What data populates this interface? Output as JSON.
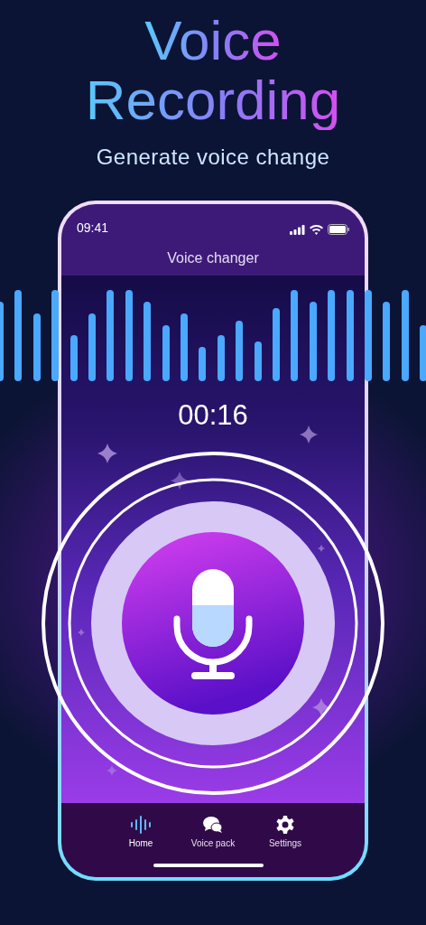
{
  "headline": {
    "line_1": "Voice",
    "line_2": "Recording"
  },
  "subtitle": "Generate voice change",
  "phone": {
    "status_bar": {
      "time": "09:41"
    },
    "title": "Voice changer",
    "timer": "00:16",
    "tabs": [
      {
        "label": "Home",
        "kind": "waveform",
        "selected": true
      },
      {
        "label": "Voice pack",
        "kind": "chat",
        "selected": false
      },
      {
        "label": "Settings",
        "kind": "gear",
        "selected": false
      }
    ]
  }
}
